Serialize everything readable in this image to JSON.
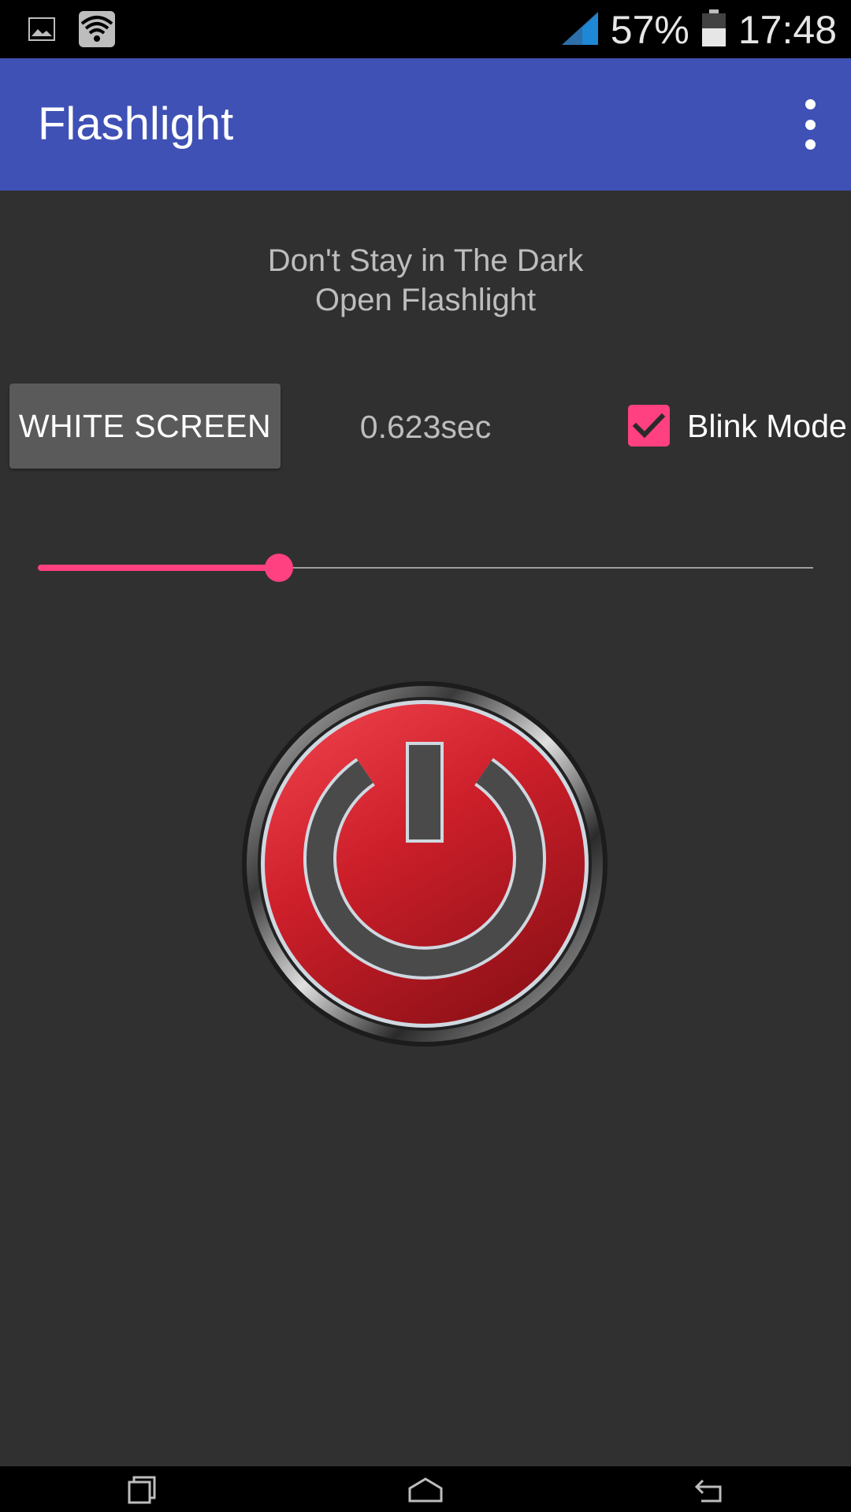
{
  "status_bar": {
    "battery_percent": "57%",
    "time": "17:48",
    "icons": [
      "image-icon",
      "wifi-icon",
      "signal-icon",
      "battery-icon"
    ]
  },
  "app_bar": {
    "title": "Flashlight",
    "overflow_icon": "more-vert-icon"
  },
  "main": {
    "tagline_line1": "Don't Stay in The Dark",
    "tagline_line2": "Open Flashlight",
    "white_screen_label": "WHITE SCREEN",
    "interval_label": "0.623sec",
    "blink_mode_label": "Blink Mode",
    "blink_mode_checked": true,
    "slider_value_fraction": 0.311,
    "power_button_icon": "power-icon"
  },
  "colors": {
    "app_bar": "#3f51b5",
    "accent": "#ff4081",
    "background": "#303030",
    "power_red": "#d32030"
  },
  "nav_bar": {
    "icons": [
      "recent-apps-icon",
      "home-icon",
      "back-icon"
    ]
  }
}
